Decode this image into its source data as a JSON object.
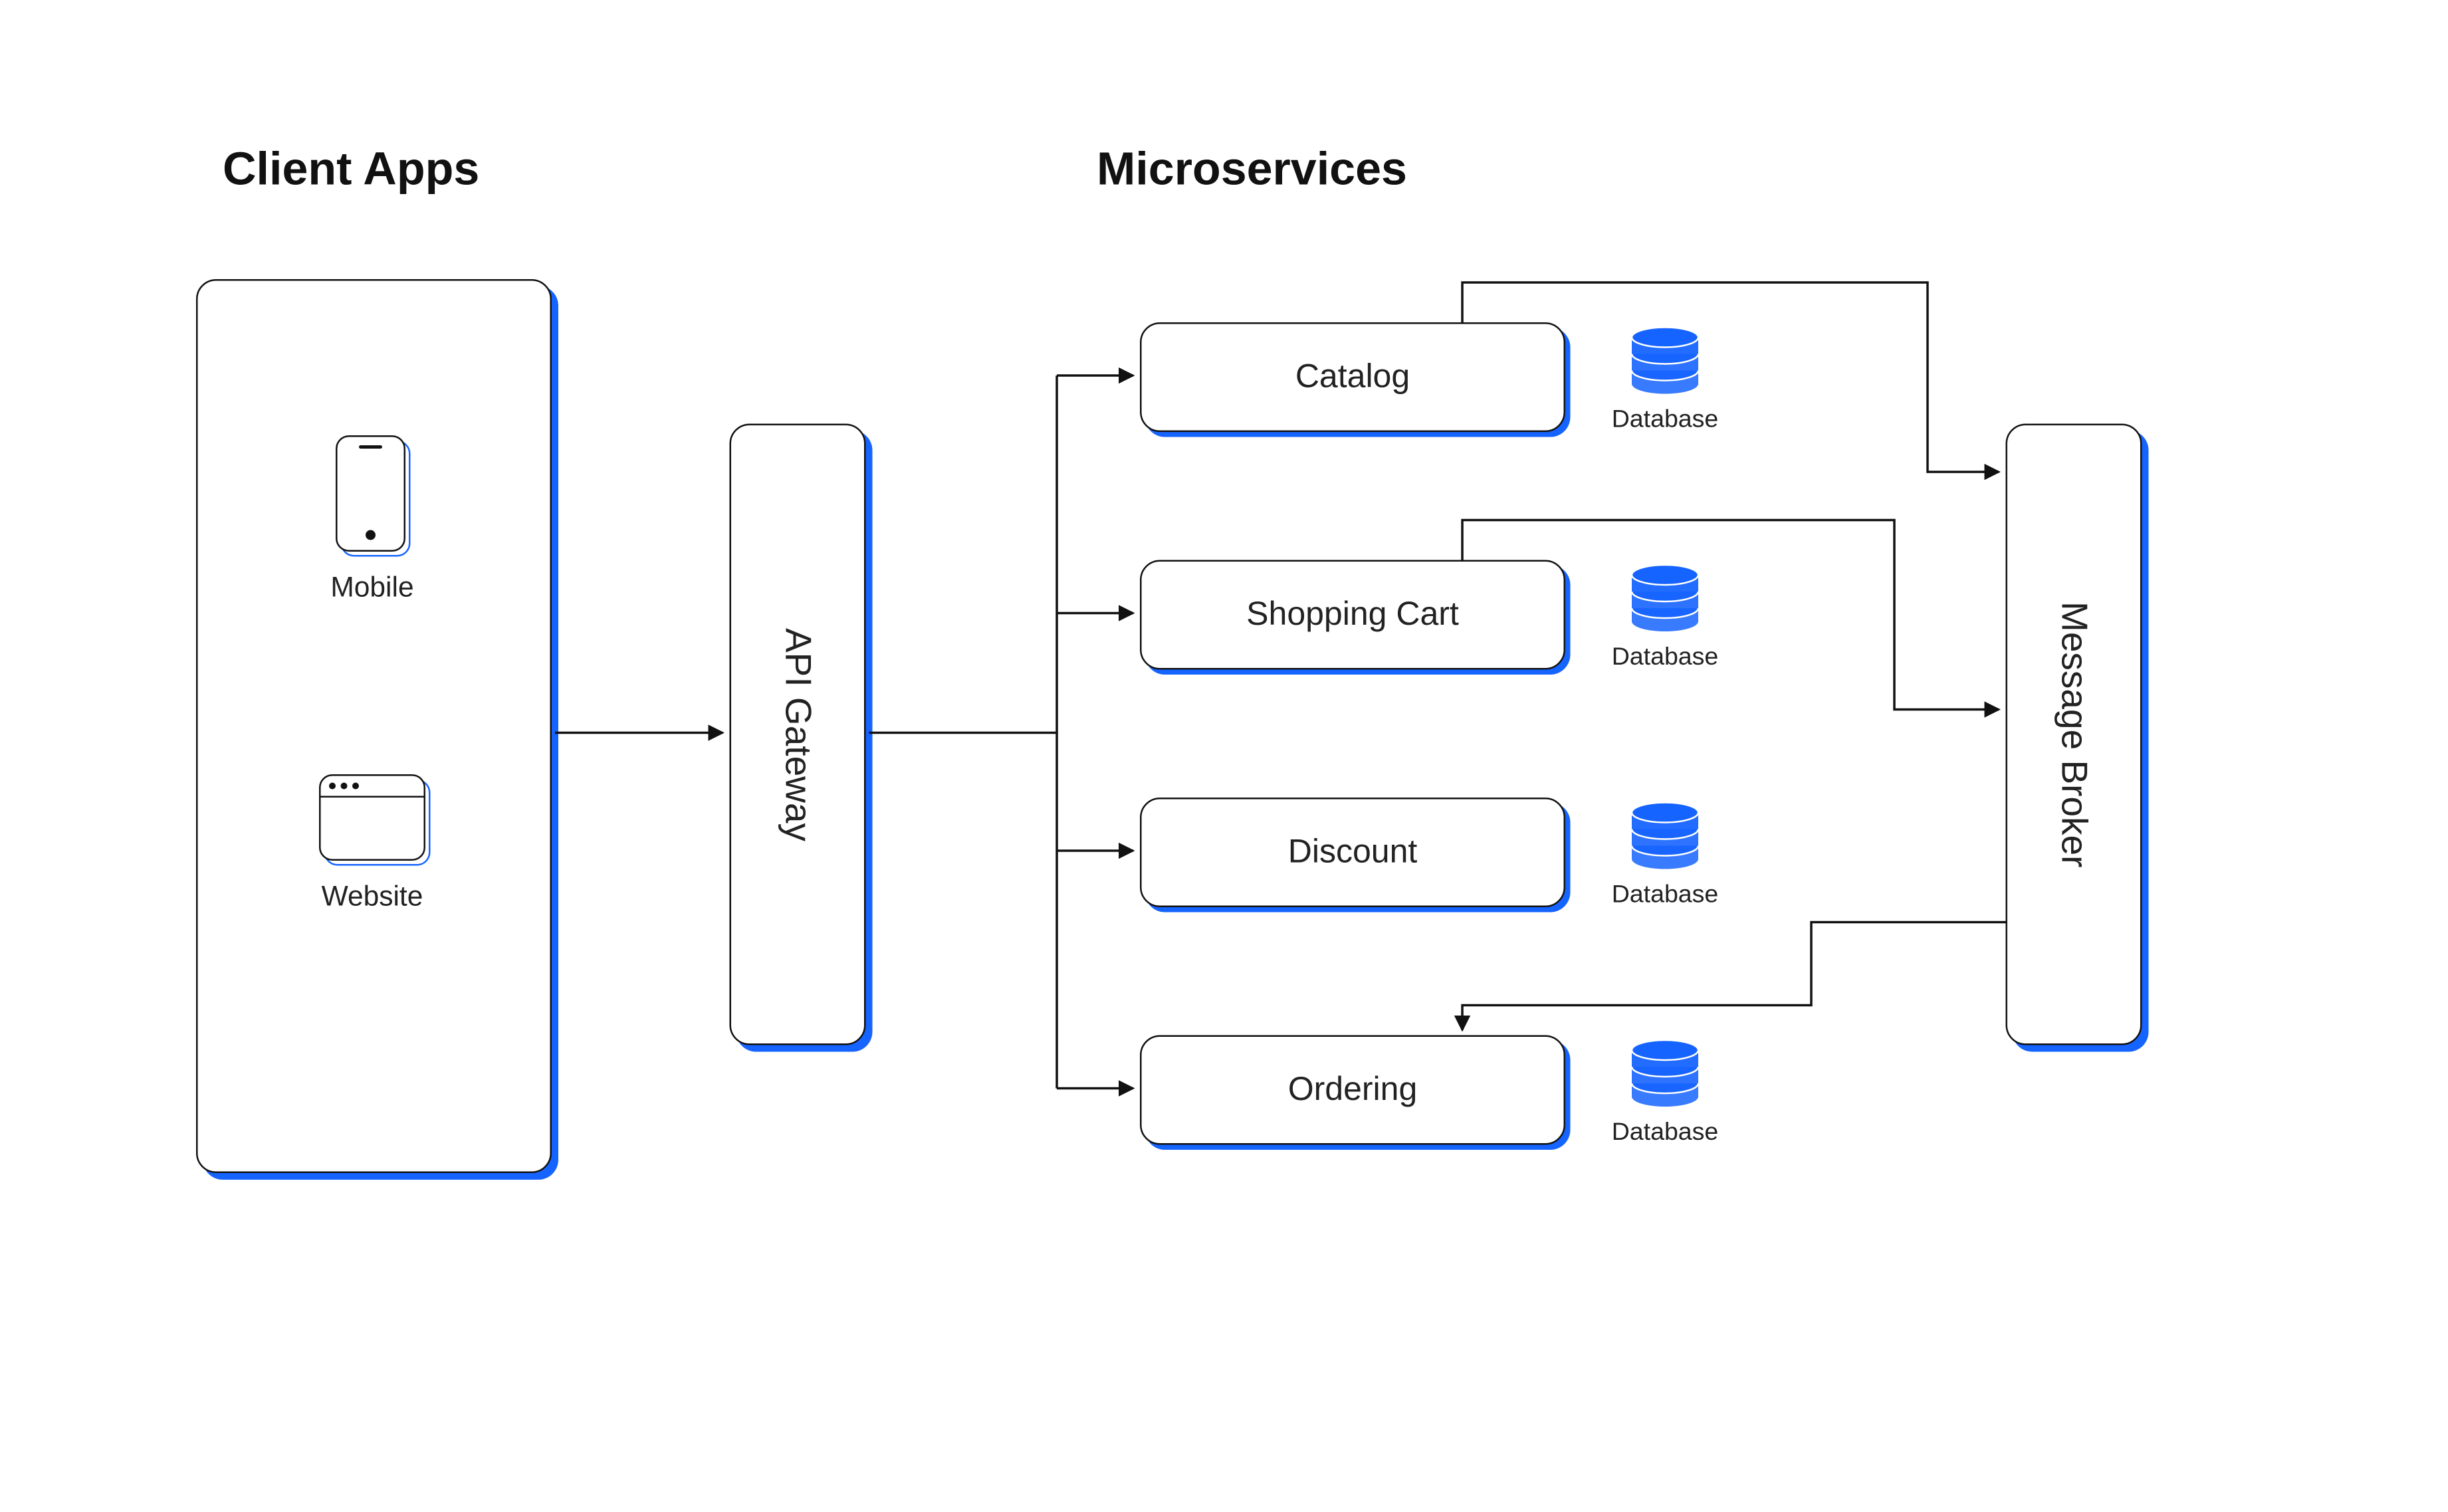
{
  "headings": {
    "clients": "Client Apps",
    "services": "Microservices"
  },
  "clients": {
    "mobile": "Mobile",
    "website": "Website"
  },
  "gateway": {
    "label": "API Gateway"
  },
  "services": [
    {
      "name": "Catalog",
      "db": "Database"
    },
    {
      "name": "Shopping Cart",
      "db": "Database"
    },
    {
      "name": "Discount",
      "db": "Database"
    },
    {
      "name": "Ordering",
      "db": "Database"
    }
  ],
  "broker": {
    "label": "Message Broker"
  }
}
